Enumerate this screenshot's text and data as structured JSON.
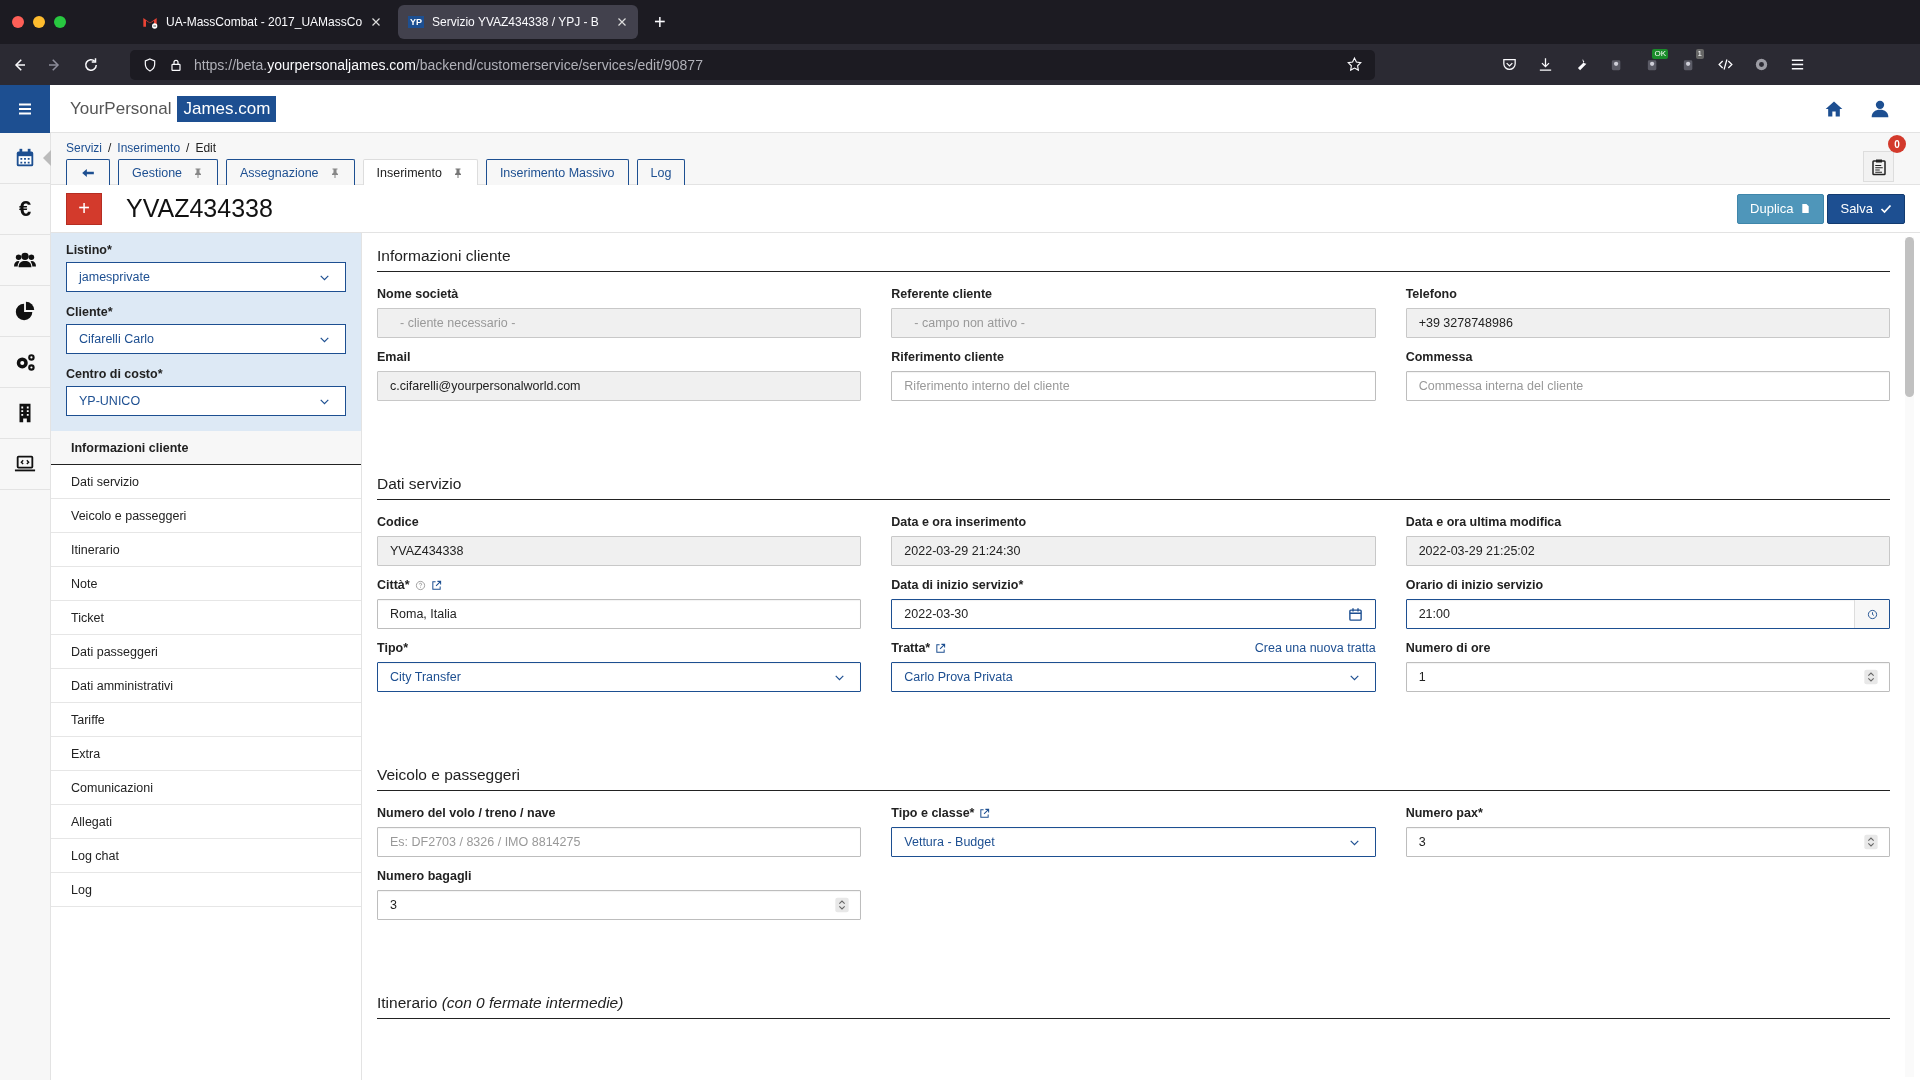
{
  "browser": {
    "tabs": [
      {
        "favicon": {
          "kind": "mail"
        },
        "title": "UA-MassCombat - 2017_UAMassCo",
        "selected": false
      },
      {
        "favicon": {
          "kind": "text",
          "text": "YP"
        },
        "title": "Servizio YVAZ434338 / YPJ - B",
        "selected": true
      }
    ],
    "new_tab": "+",
    "url_parts": [
      {
        "text": "https://beta.",
        "strong": false
      },
      {
        "text": "yourpersonaljames.com",
        "strong": true
      },
      {
        "text": "/backend/customerservice/services/edit/90877",
        "strong": false
      }
    ],
    "extension_badges": [
      "OK",
      "1"
    ]
  },
  "header": {
    "logo_left": "YourPersonal",
    "logo_right": "James.com"
  },
  "rail": [
    {
      "kind": "calendar",
      "selected": true
    },
    {
      "kind": "glyph",
      "text": "€",
      "selected": false
    },
    {
      "kind": "people",
      "selected": false
    },
    {
      "kind": "pie",
      "selected": false
    },
    {
      "kind": "gears",
      "selected": false
    },
    {
      "kind": "building",
      "selected": false
    },
    {
      "kind": "laptop",
      "selected": false
    }
  ],
  "breadcrumb": {
    "separator": "/",
    "items": [
      {
        "text": "Servizi",
        "link": true
      },
      {
        "text": "Inserimento",
        "link": true
      },
      {
        "text": "Edit",
        "link": false
      }
    ]
  },
  "tabs": [
    {
      "kind": "back",
      "selected": false
    },
    {
      "kind": "label",
      "label": "Gestione",
      "pinned": true,
      "selected": false
    },
    {
      "kind": "label",
      "label": "Assegnazione",
      "pinned": true,
      "selected": false
    },
    {
      "kind": "label",
      "label": "Inserimento",
      "pinned": true,
      "selected": true
    },
    {
      "kind": "label",
      "label": "Inserimento Massivo",
      "pinned": false,
      "selected": false
    },
    {
      "kind": "label",
      "label": "Log",
      "pinned": false,
      "selected": false
    }
  ],
  "notifications": {
    "count": "0"
  },
  "title": {
    "add": "+",
    "code": "YVAZ434338"
  },
  "actions": [
    {
      "kind": "secondary",
      "label": "Duplica"
    },
    {
      "kind": "primary",
      "label": "Salva"
    }
  ],
  "sidebar": {
    "filters": [
      {
        "label": "Listino*",
        "value": "jamesprivate"
      },
      {
        "label": "Cliente*",
        "value": "Cifarelli Carlo"
      },
      {
        "label": "Centro di costo*",
        "value": "YP-UNICO"
      }
    ],
    "nav": [
      {
        "label": "Informazioni cliente",
        "selected": true
      },
      {
        "label": "Dati servizio",
        "selected": false
      },
      {
        "label": "Veicolo e passeggeri",
        "selected": false
      },
      {
        "label": "Itinerario",
        "selected": false
      },
      {
        "label": "Note",
        "selected": false
      },
      {
        "label": "Ticket",
        "selected": false
      },
      {
        "label": "Dati passeggeri",
        "selected": false
      },
      {
        "label": "Dati amministrativi",
        "selected": false
      },
      {
        "label": "Tariffe",
        "selected": false
      },
      {
        "label": "Extra",
        "selected": false
      },
      {
        "label": "Comunicazioni",
        "selected": false
      },
      {
        "label": "Allegati",
        "selected": false
      },
      {
        "label": "Log chat",
        "selected": false
      },
      {
        "label": "Log",
        "selected": false
      }
    ]
  },
  "sections": [
    {
      "title": "Informazioni cliente",
      "fields": [
        {
          "label": "Nome società",
          "kind": "text",
          "placeholder": "- cliente necessario -",
          "readonly": true
        },
        {
          "label": "Referente cliente",
          "kind": "text",
          "placeholder": "- campo non attivo -",
          "readonly": true
        },
        {
          "label": "Telefono",
          "kind": "text",
          "value": "+39 3278748986",
          "readonly": true
        },
        {
          "label": "Email",
          "kind": "text",
          "value": "c.cifarelli@yourpersonalworld.com",
          "readonly": true
        },
        {
          "label": "Riferimento cliente",
          "kind": "text",
          "placeholder": "Riferimento interno del cliente",
          "readonly": false
        },
        {
          "label": "Commessa",
          "kind": "text",
          "placeholder": "Commessa interna del cliente",
          "readonly": false
        }
      ]
    },
    {
      "title": "Dati servizio",
      "fields": [
        {
          "label": "Codice",
          "kind": "text",
          "value": "YVAZ434338",
          "readonly": true
        },
        {
          "label": "Data e ora inserimento",
          "kind": "text",
          "value": "2022-03-29 21:24:30",
          "readonly": true
        },
        {
          "label": "Data e ora ultima modifica",
          "kind": "text",
          "value": "2022-03-29 21:25:02",
          "readonly": true
        },
        {
          "label": "Città*",
          "kind": "text",
          "value": "Roma, Italia",
          "readonly": false,
          "help": true,
          "external_link": true
        },
        {
          "label": "Data di inizio servizio*",
          "kind": "date",
          "value": "2022-03-30",
          "readonly": false
        },
        {
          "label": "Orario di inizio servizio",
          "kind": "time",
          "value": "21:00",
          "readonly": false
        },
        {
          "label": "Tipo*",
          "kind": "select",
          "value": "City Transfer",
          "readonly": false
        },
        {
          "label": "Tratta*",
          "kind": "select",
          "value": "Carlo Prova Privata",
          "readonly": false,
          "external_link": true,
          "link": "Crea una nuova tratta"
        },
        {
          "label": "Numero di ore",
          "kind": "number",
          "value": "1",
          "readonly": false
        }
      ]
    },
    {
      "title": "Veicolo e passeggeri",
      "fields": [
        {
          "label": "Numero del volo / treno / nave",
          "kind": "text",
          "placeholder": "Es: DF2703 / 8326 / IMO 8814275",
          "readonly": false
        },
        {
          "label": "Tipo e classe*",
          "kind": "select",
          "value": "Vettura - Budget",
          "readonly": false,
          "external_link": true
        },
        {
          "label": "Numero pax*",
          "kind": "number",
          "value": "3",
          "readonly": false
        },
        {
          "label": "Numero bagagli",
          "kind": "number",
          "value": "3",
          "readonly": false
        }
      ]
    },
    {
      "title": "Itinerario *(con 0 fermate intermedie)*"
    }
  ]
}
